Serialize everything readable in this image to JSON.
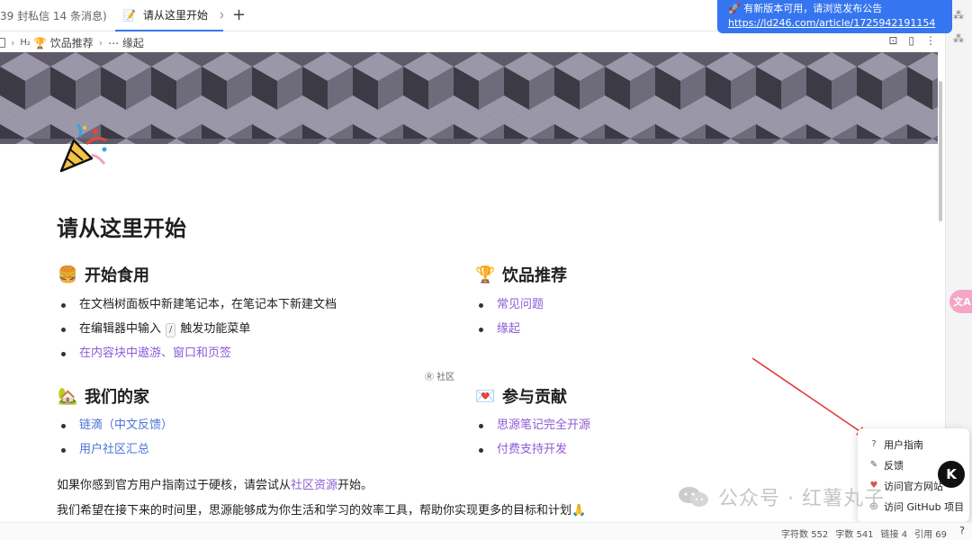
{
  "tabs": [
    {
      "label": "39 封私信 14 条消息) 儿"
    },
    {
      "label": "请从这里开始",
      "icon": "📝",
      "close": "×"
    }
  ],
  "tab_add": "+",
  "breadcrumb": {
    "h2_marker": "H₂",
    "items": [
      "🏆 饮品推荐",
      "⋯ 缘起"
    ]
  },
  "notification": {
    "message": "🚀 有新版本可用，请浏览发布公告",
    "link": "https://ld246.com/article/1725942191154"
  },
  "document": {
    "icon": "🎉",
    "title": "请从这里开始",
    "sections": [
      {
        "emoji": "🍔",
        "heading": "开始食用",
        "items": [
          {
            "pre": "在文档树面板中新建笔记本，在笔记本下新建文档"
          },
          {
            "pre": "在编辑器中输入",
            "kbd": "/",
            "post": "触发功能菜单"
          },
          {
            "link1": "在内容块中遨游",
            "mid": "、",
            "link2": "窗口和页签"
          }
        ]
      },
      {
        "emoji": "🏆",
        "heading": "饮品推荐",
        "items": [
          {
            "link": "常见问题"
          },
          {
            "link": "缘起"
          }
        ]
      },
      {
        "emoji": "🏡",
        "heading": "我们的家",
        "items": [
          {
            "link": "链滴（中文反馈）"
          },
          {
            "link": "用户社区汇总"
          }
        ]
      },
      {
        "emoji": "💌",
        "heading": "参与贡献",
        "items": [
          {
            "link": "思源笔记完全开源"
          },
          {
            "link": "付费支持开发"
          }
        ]
      }
    ],
    "community_tag": "Ⓡ 社区",
    "para1": {
      "pre": "如果你感到官方用户指南过于硬核，请尝试从",
      "link": "社区资源",
      "post": "开始。"
    },
    "para2": "我们希望在接下来的时间里，思源能够成为你生活和学习的效率工具，帮助你实现更多的目标和计划🙏"
  },
  "help_popup": {
    "items": [
      {
        "icon": "?",
        "label": "用户指南"
      },
      {
        "icon": "✎",
        "label": "反馈"
      },
      {
        "icon": "♥",
        "label": "访问官方网站"
      },
      {
        "icon": "◎",
        "label": "访问 GitHub 项目"
      }
    ]
  },
  "avatar_letter": "K",
  "translate_label": "文A",
  "watermark": "公众号 · 红薯丸子",
  "status": {
    "chars": "字符数 552",
    "words": "字数 541",
    "links": "链接 4",
    "refs": "引用 69",
    "help": "?"
  },
  "colors": {
    "accent": "#3575f0",
    "link": "#8e5cd6",
    "link_blue": "#4b73d6",
    "banner": "#5b5866"
  }
}
